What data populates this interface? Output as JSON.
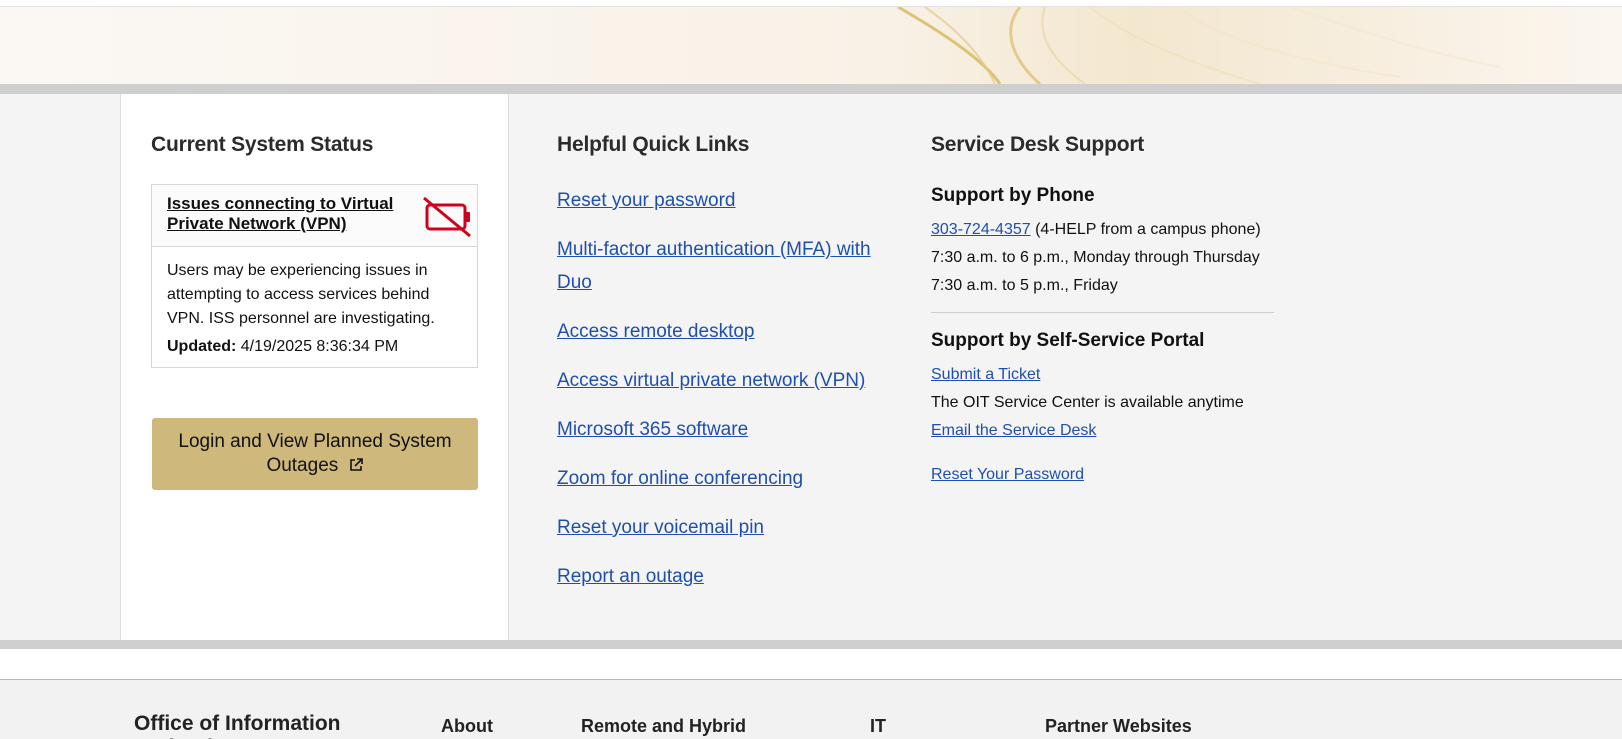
{
  "status": {
    "title": "Current System Status",
    "incident_title": "Issues connecting to Virtual Private Network (VPN)",
    "incident_body": "Users may be experiencing issues in attempting to access services behind VPN. ISS personnel are investigating.",
    "updated_label": "Updated:",
    "updated_value": "4/19/2025 8:36:34 PM",
    "incident_icon": "no-connection-icon",
    "alert_color": "#d0021b",
    "button_label": "Login and View Planned System Outages",
    "button_icon": "external-link-icon",
    "button_color": "#cfb87c"
  },
  "quick_links": {
    "title": "Helpful Quick Links",
    "items": [
      "Reset your password",
      "Multi-factor authentication (MFA) with Duo",
      "Access remote desktop",
      "Access virtual private network (VPN)",
      "Microsoft 365 software",
      "Zoom for online conferencing",
      "Reset your voicemail pin",
      "Report an outage"
    ]
  },
  "service_desk": {
    "title": "Service Desk Support",
    "phone_heading": "Support by Phone",
    "phone_number": "303-724-4357",
    "phone_note": "(4-HELP from a campus phone)",
    "hours_1": "7:30 a.m. to 6 p.m., Monday through Thursday",
    "hours_2": "7:30 a.m. to 5 p.m., Friday",
    "portal_heading": "Support by Self-Service Portal",
    "submit_ticket": "Submit a Ticket",
    "availability": "The OIT Service Center is available anytime",
    "email_link": "Email the Service Desk",
    "reset_link": "Reset Your Password"
  },
  "footer": {
    "title": "Office of Information Technology",
    "columns": [
      "About",
      "Remote and Hybrid",
      "IT",
      "Partner Websites"
    ]
  },
  "link_color": "#1f4fad"
}
